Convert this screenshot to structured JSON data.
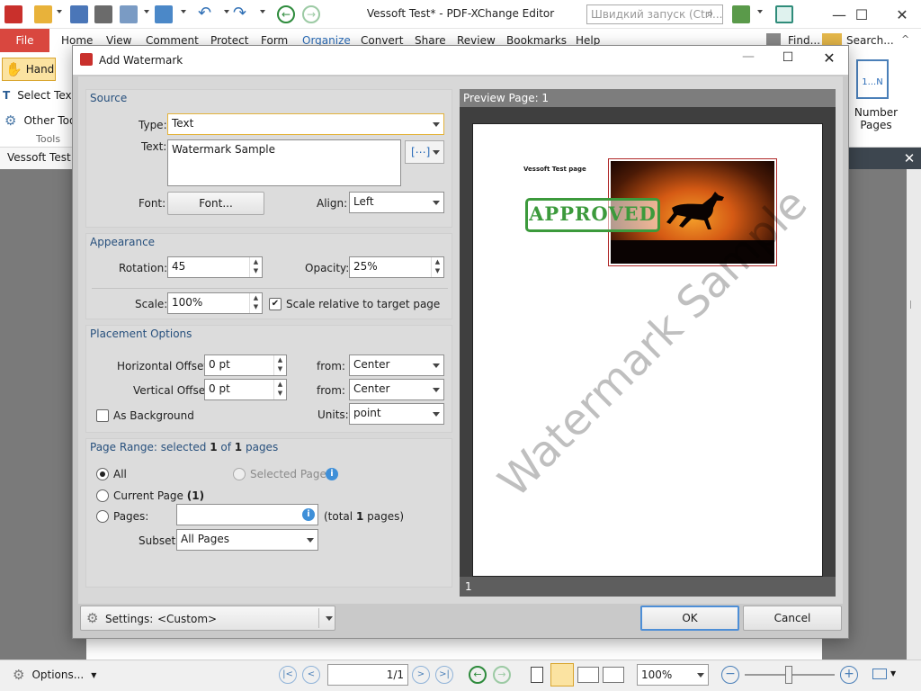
{
  "app": {
    "title": "Vessoft Test* - PDF-XChange Editor",
    "quick_launch_placeholder": "Швидкий запуск (Ctrl...",
    "find_label": "Find...",
    "search_label": "Search..."
  },
  "ribbon": {
    "file_label": "File",
    "tabs": [
      "Home",
      "View",
      "Comment",
      "Protect",
      "Form",
      "Organize",
      "Convert",
      "Share",
      "Review",
      "Bookmarks",
      "Help"
    ],
    "tools": {
      "hand_label": "Hand",
      "select_text_label": "Select Text",
      "other_tools_label": "Other Tools",
      "group_label": "Tools"
    },
    "number_pages": {
      "icon_text": "1...N",
      "label_line1": "Number",
      "label_line2": "Pages"
    }
  },
  "document": {
    "tab_label": "Vessoft Test *"
  },
  "dialog": {
    "title": "Add Watermark",
    "source": {
      "header": "Source",
      "type_label": "Type:",
      "type_value": "Text",
      "text_label": "Text:",
      "text_value": "Watermark Sample",
      "font_label": "Font:",
      "font_button": "Font...",
      "align_label": "Align:",
      "align_value": "Left"
    },
    "appearance": {
      "header": "Appearance",
      "rotation_label": "Rotation:",
      "rotation_value": "45",
      "opacity_label": "Opacity:",
      "opacity_value": "25%",
      "scale_label": "Scale:",
      "scale_value": "100%",
      "scale_relative_label": "Scale relative to target page"
    },
    "placement": {
      "header": "Placement Options",
      "h_offset_label": "Horizontal Offset:",
      "h_offset_value": "0 pt",
      "h_from_label": "from:",
      "h_from_value": "Center",
      "v_offset_label": "Vertical Offset:",
      "v_offset_value": "0 pt",
      "v_from_label": "from:",
      "v_from_value": "Center",
      "as_background_label": "As Background",
      "units_label": "Units:",
      "units_value": "point"
    },
    "page_range": {
      "header_prefix": "Page Range: selected ",
      "selected": "1",
      "of": " of ",
      "total": "1",
      "header_suffix": " pages",
      "all_label": "All",
      "selected_pages_label": "Selected Pages",
      "current_page_label": "Current Page ",
      "current_page_value": "(1)",
      "pages_label": "Pages:",
      "pages_value": "",
      "total_prefix": "(total ",
      "total_value": "1",
      "total_suffix": " pages)",
      "subset_label": "Subset:",
      "subset_value": "All Pages"
    },
    "preview": {
      "header": "Preview Page: 1",
      "page_heading": "Vessoft Test page",
      "stamp_text": "APPROVED",
      "watermark_text": "Watermark Sample",
      "page_number": "1"
    },
    "settings_label": "Settings:",
    "settings_value": "<Custom>",
    "ok_label": "OK",
    "cancel_label": "Cancel"
  },
  "statusbar": {
    "options_label": "Options...",
    "page_input": "1/1",
    "zoom_value": "100%"
  },
  "colors": {
    "file_tab": "#d9473f",
    "stamp_green": "#3c9a3c",
    "section_header": "#27507d"
  }
}
